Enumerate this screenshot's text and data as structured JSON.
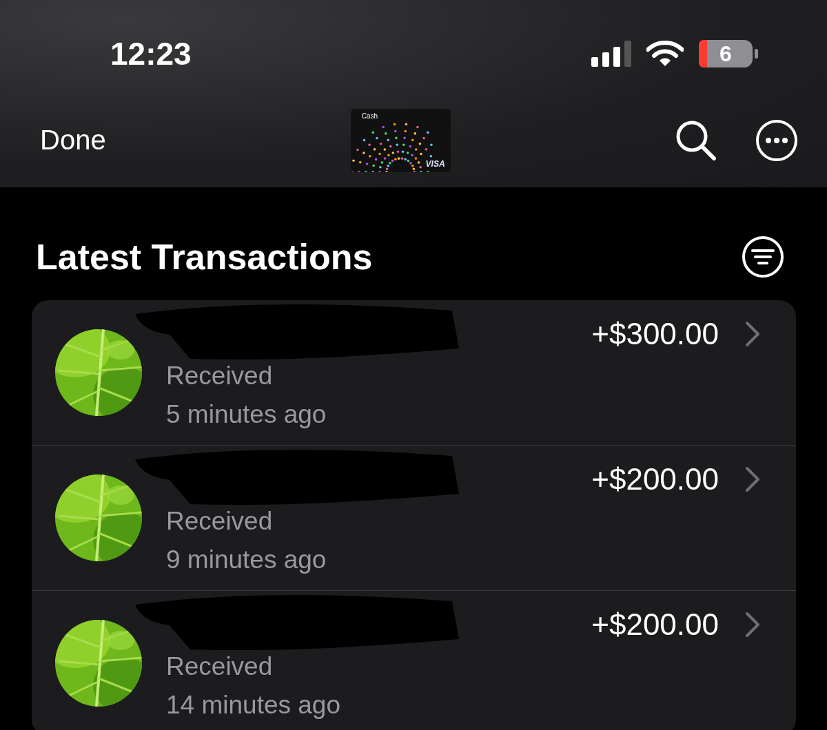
{
  "status_bar": {
    "time": "12:23",
    "battery": "6"
  },
  "nav": {
    "done": "Done",
    "card": {
      "brand": "Cash",
      "network": "VISA"
    }
  },
  "section": {
    "title": "Latest Transactions"
  },
  "transactions": [
    {
      "status": "Received",
      "time": "5 minutes ago",
      "amount": "+$300.00"
    },
    {
      "status": "Received",
      "time": "9 minutes ago",
      "amount": "+$200.00"
    },
    {
      "status": "Received",
      "time": "14 minutes ago",
      "amount": "+$200.00"
    }
  ]
}
